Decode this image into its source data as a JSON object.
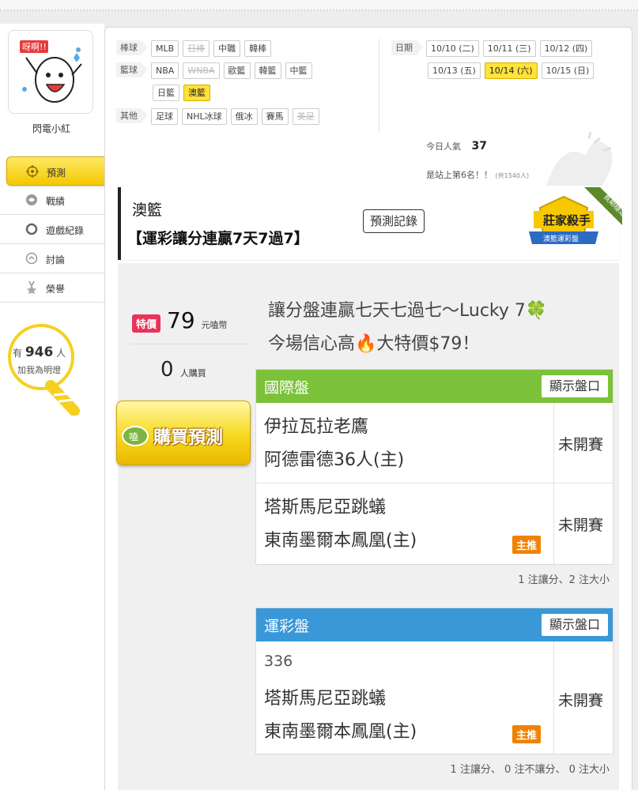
{
  "user": {
    "name": "閃電小紅",
    "avatar_text": "呀啊!!"
  },
  "sidebar": {
    "items": [
      {
        "label": "預測",
        "icon": "target-icon",
        "active": true
      },
      {
        "label": "戰績",
        "icon": "record-icon"
      },
      {
        "label": "遊戲紀錄",
        "icon": "circle-icon"
      },
      {
        "label": "討論",
        "icon": "chat-icon"
      },
      {
        "label": "榮譽",
        "icon": "medal-icon"
      }
    ],
    "lights": {
      "prefix": "有",
      "count": "946",
      "suffix": "人",
      "text": "加我為明燈"
    }
  },
  "filters": {
    "baseball": {
      "label": "棒球",
      "items": [
        "MLB",
        "日棒",
        "中職",
        "韓棒"
      ]
    },
    "basketball": {
      "label": "籃球",
      "items": [
        "NBA",
        "WNBA",
        "歐籃",
        "韓籃",
        "中籃",
        "日籃",
        "澳籃"
      ]
    },
    "other": {
      "label": "其他",
      "items": [
        "足球",
        "NHL冰球",
        "俄冰",
        "賽馬",
        "美足"
      ]
    },
    "date": {
      "label": "日期",
      "items": [
        "10/10 (二)",
        "10/11 (三)",
        "10/12 (四)",
        "10/13 (五)",
        "10/14 (六)",
        "10/15 (日)"
      ]
    }
  },
  "stats": {
    "popularity_label": "今日人氣",
    "popularity": "37",
    "rank_text": "是站上第6名！！",
    "rank_total": "(共1540人)"
  },
  "banner": {
    "category": "澳籃",
    "title": "【運彩讓分連贏7天7過7】",
    "record_button": "預測記錄",
    "badge_title": "莊家殺手",
    "badge_sub": "澳籃運彩盤",
    "ribbon": "長期穩定"
  },
  "purchase": {
    "special_label": "特價",
    "price": "79",
    "unit": "元嗑幣",
    "buyers": "0",
    "buyers_unit": "人購買",
    "buy_button": "購買預測"
  },
  "description": {
    "line1": "讓分盤連贏七天七過七～Lucky 7🍀",
    "line2": "今場信心高🔥大特價$79！"
  },
  "international": {
    "title": "國際盤",
    "show_button": "顯示盤口",
    "games": [
      {
        "away": "伊拉瓦拉老鷹",
        "home": "阿德雷德36人(主)",
        "status": "未開賽",
        "pick": ""
      },
      {
        "away": "塔斯馬尼亞跳蟻",
        "home": "東南墨爾本鳳凰(主)",
        "status": "未開賽",
        "pick": "主推"
      }
    ],
    "summary": "1 注讓分、2 注大小"
  },
  "sportslottery": {
    "title": "運彩盤",
    "show_button": "顯示盤口",
    "games": [
      {
        "code": "336",
        "away": "塔斯馬尼亞跳蟻",
        "home": "東南墨爾本鳳凰(主)",
        "status": "未開賽",
        "pick": "主推"
      }
    ],
    "summary": "1 注讓分、 0 注不讓分、 0 注大小"
  },
  "colors": {
    "accent_yellow": "#f7d81c",
    "international_header": "#7cc13a",
    "lottery_header": "#3a98d8",
    "special_red": "#e9335b",
    "pick_orange": "#f08200"
  }
}
